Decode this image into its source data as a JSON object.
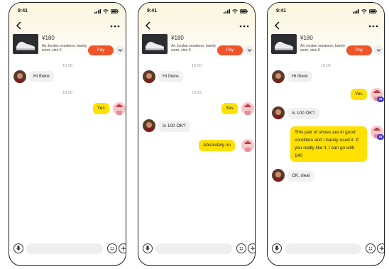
{
  "status": {
    "time": "9:41"
  },
  "product": {
    "price": "¥180",
    "description": "Air Jordan sneakers, barely worn, size 9",
    "pay_label": "Pay"
  },
  "timestamps": [
    "10:00",
    "10:02",
    "18:00"
  ],
  "messages": {
    "hi_there": "Hi there",
    "yes": "Yes",
    "is_100_ok": "Is 100 OK?",
    "absolutely_no": "Absolutely no",
    "ai_reply": "This pair of shoes are in good condition and I barely used it. If you really like it, I can go with 140",
    "ok_deal": "OK, deal"
  },
  "badges": {
    "ai": "AI"
  },
  "icons": {
    "back": "chevron-left-icon",
    "more": "more-dots-icon",
    "expand": "chevron-down-icon",
    "mic": "microphone-icon",
    "emoji": "smiley-icon",
    "plus": "plus-icon"
  },
  "colors": {
    "accent_pay": "#f2542a",
    "bubble_self": "#ffe100",
    "bubble_other": "#f1f1f1",
    "ai_badge": "#4a3fd6"
  }
}
